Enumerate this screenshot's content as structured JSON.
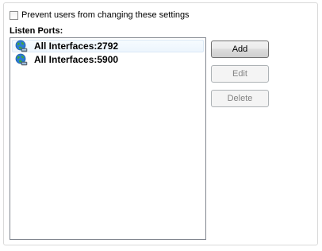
{
  "settings": {
    "prevent_label": "Prevent users from changing these settings",
    "prevent_checked": false
  },
  "listen_ports": {
    "label": "Listen Ports:",
    "items": [
      {
        "label": "All Interfaces:2792",
        "icon": "network-globe-icon",
        "focused": true
      },
      {
        "label": "All Interfaces:5900",
        "icon": "network-globe-icon",
        "focused": false
      }
    ]
  },
  "buttons": {
    "add": {
      "label": "Add",
      "enabled": true
    },
    "edit": {
      "label": "Edit",
      "enabled": false
    },
    "delete": {
      "label": "Delete",
      "enabled": false
    }
  },
  "colors": {
    "globe_blue": "#2b7bd4",
    "globe_green": "#3fa63a",
    "disabled_text": "#838383"
  }
}
